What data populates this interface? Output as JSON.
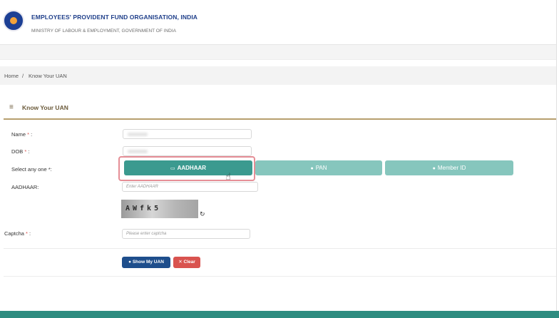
{
  "header": {
    "org_title": "EMPLOYEES' PROVIDENT FUND ORGANISATION, INDIA",
    "org_subtitle": "MINISTRY OF LABOUR & EMPLOYMENT, GOVERNMENT OF INDIA",
    "logo_icon": "epfo-emblem-icon"
  },
  "breadcrumb": {
    "home": "Home",
    "separator": "/",
    "current": "Know Your UAN"
  },
  "panel": {
    "menu_icon": "≡",
    "title": "Know Your UAN"
  },
  "form": {
    "name_label": "Name",
    "dob_label": "DOB",
    "select_label": "Select any one *:",
    "aadhaar_label": "AADHAAR:",
    "captcha_label": "Captcha",
    "required_mark": "*",
    "label_suffix": ":",
    "aadhaar_placeholder": "Enter AADHAAR",
    "captcha_placeholder": "Please enter captcha",
    "captcha_text": "AWfk5",
    "options": [
      {
        "label": "AADHAAR",
        "icon": "id-card-icon",
        "selected": true
      },
      {
        "label": "PAN",
        "icon": "user-icon",
        "selected": false
      },
      {
        "label": "Member ID",
        "icon": "user-icon",
        "selected": false
      }
    ]
  },
  "actions": {
    "show_uan": "Show My UAN",
    "clear": "Clear"
  },
  "colors": {
    "accent": "#3b9a8f",
    "accent_light": "#86c6bd",
    "primary": "#1e4e8c",
    "danger": "#d9534f",
    "brand_title": "#1f3f8a",
    "panel_title": "#6b5a3a"
  }
}
